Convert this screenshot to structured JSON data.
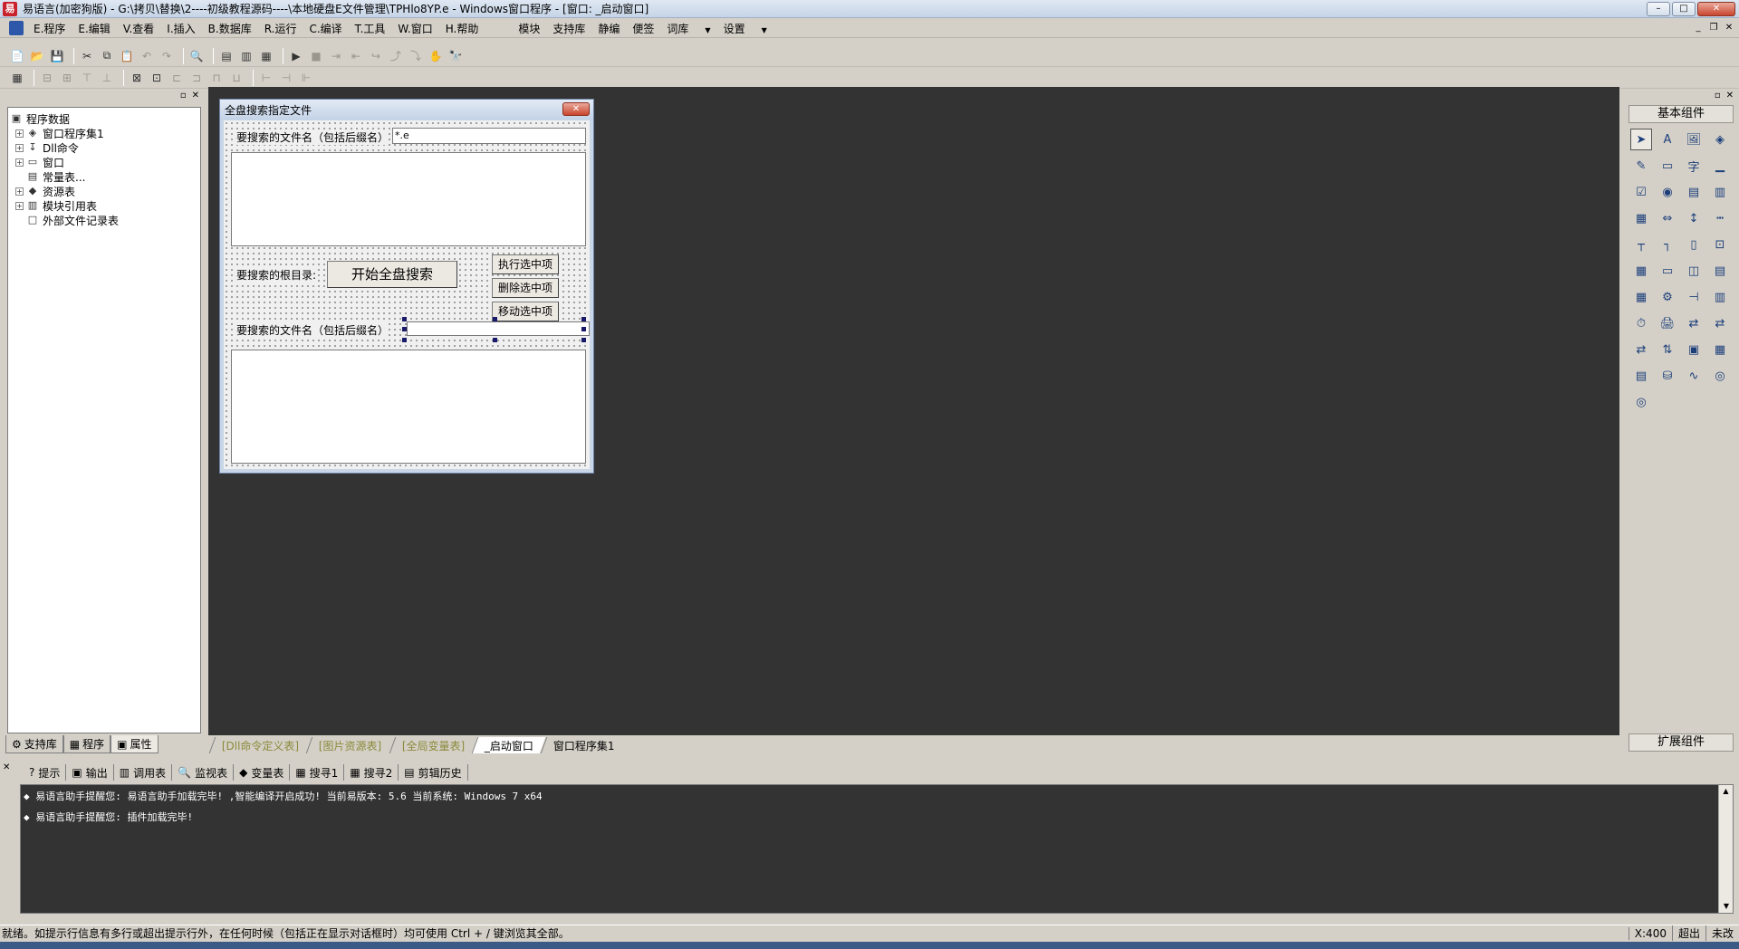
{
  "window": {
    "title": "易语言(加密狗版) - G:\\拷贝\\替换\\2----初级教程源码----\\本地硬盘E文件管理\\TPHlo8YP.e - Windows窗口程序 - [窗口: _启动窗口]",
    "min": "–",
    "max": "□",
    "close": "✕"
  },
  "menu": {
    "items": [
      "E.程序",
      "E.编辑",
      "V.查看",
      "I.插入",
      "B.数据库",
      "R.运行",
      "C.编译",
      "T.工具",
      "W.窗口",
      "H.帮助"
    ],
    "extra": [
      "模块",
      "支持库",
      "静编",
      "便签",
      "词库",
      "设置"
    ],
    "dropdown_arrow": "▼",
    "mdi_min": "_",
    "mdi_restore": "❐",
    "mdi_close": "✕"
  },
  "toolbar1": [
    "📄",
    "📂",
    "💾",
    "✂",
    "⧉",
    "📋",
    "↶",
    "↷",
    "🔍",
    "▤",
    "▥",
    "▦",
    "▶",
    "■",
    "⇥",
    "⇤",
    "↪",
    "⤴",
    "⤵",
    "✋",
    "🔭"
  ],
  "toolbar2": [
    "▦",
    "⊟",
    "⊞",
    "⊤",
    "⊥",
    "⊠",
    "⊡",
    "⊏",
    "⊐",
    "⊓",
    "⊔",
    "⊢",
    "⊣",
    "⊩"
  ],
  "left_panel": {
    "head_buttons": [
      "▫",
      "✕"
    ],
    "tree": [
      {
        "label": "程序数据",
        "exp": "",
        "icon": "▣",
        "child": false
      },
      {
        "label": "窗口程序集1",
        "exp": "+",
        "icon": "◈",
        "child": true
      },
      {
        "label": "Dll命令",
        "exp": "+",
        "icon": "↧",
        "child": true
      },
      {
        "label": "窗口",
        "exp": "+",
        "icon": "▭",
        "child": true
      },
      {
        "label": "常量表...",
        "exp": "",
        "icon": "▤",
        "child": true
      },
      {
        "label": "资源表",
        "exp": "+",
        "icon": "◆",
        "child": true
      },
      {
        "label": "模块引用表",
        "exp": "+",
        "icon": "▥",
        "child": true
      },
      {
        "label": "外部文件记录表",
        "exp": "",
        "icon": "□",
        "child": true
      }
    ],
    "tabs": [
      {
        "label": "支持库",
        "icon": "⚙"
      },
      {
        "label": "程序",
        "icon": "▦"
      },
      {
        "label": "属性",
        "icon": "▣"
      }
    ]
  },
  "form": {
    "title": "全盘搜索指定文件",
    "close": "✕",
    "label_filename1": "要搜索的文件名（包括后缀名）",
    "input_filename1": "*.e",
    "label_root": "要搜索的根目录:",
    "btn_search": "开始全盘搜索",
    "btn_execute": "执行选中项",
    "btn_delete": "删除选中项",
    "btn_move": "移动选中项",
    "label_filename2": "要搜索的文件名（包括后缀名）",
    "input_filename2": ""
  },
  "design_tabs": [
    {
      "label": "[Dll命令定义表]",
      "style": "gray"
    },
    {
      "label": "[图片资源表]",
      "style": "gray"
    },
    {
      "label": "[全局变量表]",
      "style": "gray"
    },
    {
      "label": "_启动窗口",
      "style": "active"
    },
    {
      "label": "窗口程序集1",
      "style": "normal"
    }
  ],
  "right_panel": {
    "head_buttons": [
      "▫",
      "✕"
    ],
    "title": "基本组件",
    "footer": "扩展组件",
    "components": [
      "➤",
      "A",
      "🖼",
      "◈",
      "✎",
      "▭",
      "字",
      "▁",
      "☑",
      "◉",
      "▤",
      "▥",
      "▦",
      "⇔",
      "↕",
      "┅",
      "┬",
      "┐",
      "▯",
      "⊡",
      "▦",
      "▭",
      "◫",
      "▤",
      "▦",
      "⚙",
      "⊣",
      "▥",
      "⏱",
      "🖨",
      "⇄",
      "⇄",
      "⇄",
      "⇅",
      "▣",
      "▦",
      "▤",
      "⛁",
      "∿",
      "◎",
      "◎"
    ]
  },
  "output_tabs": [
    {
      "label": "提示",
      "icon": "?"
    },
    {
      "label": "输出",
      "icon": "▣"
    },
    {
      "label": "调用表",
      "icon": "▥"
    },
    {
      "label": "监视表",
      "icon": "🔍"
    },
    {
      "label": "变量表",
      "icon": "◆"
    },
    {
      "label": "搜寻1",
      "icon": "▦"
    },
    {
      "label": "搜寻2",
      "icon": "▦"
    },
    {
      "label": "剪辑历史",
      "icon": "▤"
    }
  ],
  "output_close": "✕",
  "output_lines": [
    "◆ 易语言助手提醒您: 易语言助手加载完毕! ,智能编译开启成功! 当前易版本: 5.6 当前系统: Windows 7 x64",
    "◆ 易语言助手提醒您: 插件加载完毕!"
  ],
  "scroll_up": "▲",
  "scroll_down": "▼",
  "status": {
    "message": "就绪。如提示行信息有多行或超出提示行外，在任何时候（包括正在显示对话框时）均可使用 Ctrl + / 键浏览其全部。",
    "coord": "X:400",
    "overwrite": "超出",
    "modified": "未改"
  },
  "colors": {
    "design_bg": "#333333",
    "output_bg": "#333333",
    "form_caption": "#c9d6e8",
    "close_red": "#c9452e"
  }
}
